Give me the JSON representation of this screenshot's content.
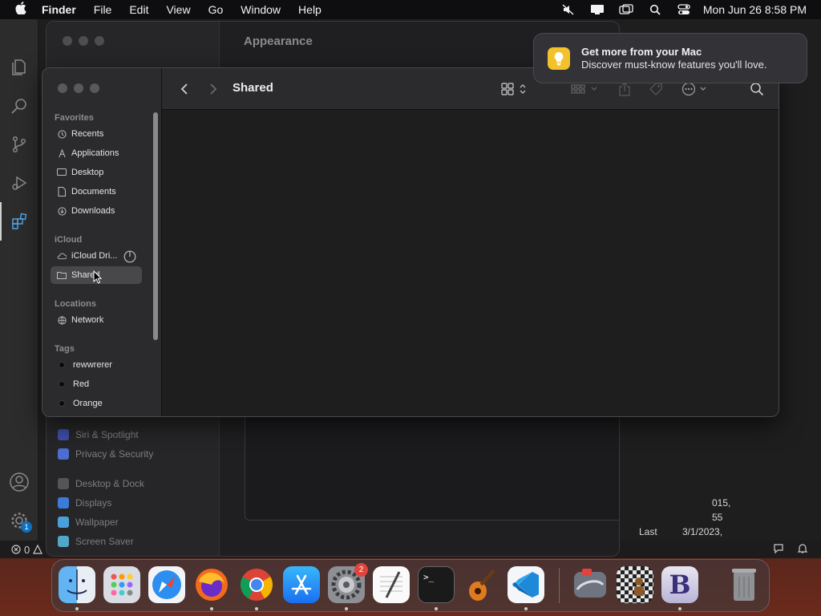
{
  "menubar": {
    "apple": "",
    "app_name": "Finder",
    "items": [
      "File",
      "Edit",
      "View",
      "Go",
      "Window",
      "Help"
    ],
    "clock": "Mon Jun 26  8:58 PM",
    "status_icons": [
      "mute-icon",
      "display-icon",
      "screen-mirror-icon",
      "spotlight-search-icon",
      "control-center-icon"
    ]
  },
  "vscode": {
    "status_errors": "0",
    "accounts_badge": "1"
  },
  "settings": {
    "title": "Appearance",
    "sidebar_items": [
      "Siri & Spotlight",
      "Privacy & Security",
      "Desktop & Dock",
      "Displays",
      "Wallpaper",
      "Screen Saver"
    ],
    "right_text": {
      "line1": "015,",
      "line2": "55",
      "last_label": "Last",
      "last_date": "3/1/2023,"
    }
  },
  "notification": {
    "title": "Get more from your Mac",
    "body": "Discover must-know features you'll love."
  },
  "finder": {
    "title": "Shared",
    "sections": {
      "favorites": "Favorites",
      "icloud": "iCloud",
      "locations": "Locations",
      "tags": "Tags"
    },
    "favorites": [
      {
        "label": "Recents",
        "icon": "clock-icon"
      },
      {
        "label": "Applications",
        "icon": "applications-icon"
      },
      {
        "label": "Desktop",
        "icon": "desktop-icon"
      },
      {
        "label": "Documents",
        "icon": "document-icon"
      },
      {
        "label": "Downloads",
        "icon": "download-icon"
      }
    ],
    "icloud": [
      {
        "label": "iCloud Dri...",
        "icon": "cloud-icon"
      },
      {
        "label": "Shared",
        "icon": "shared-folder-icon"
      }
    ],
    "locations": [
      {
        "label": "Network",
        "icon": "network-icon"
      }
    ],
    "tags": [
      {
        "label": "rewwrerer"
      },
      {
        "label": "Red"
      },
      {
        "label": "Orange"
      }
    ]
  },
  "dock": {
    "apps": [
      "Finder",
      "Launchpad",
      "Safari",
      "Firefox",
      "Chrome",
      "App Store",
      "System Settings",
      "TextEdit",
      "Terminal",
      "GarageBand",
      "Visual Studio Code",
      "Screens",
      "Chess",
      "BBEdit",
      "Trash"
    ],
    "settings_badge": "2"
  }
}
